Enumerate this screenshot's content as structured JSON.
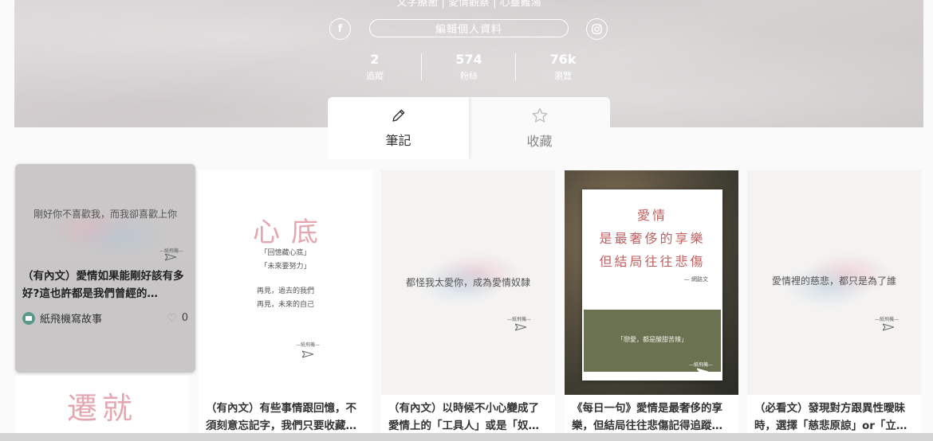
{
  "profile": {
    "bio": "文字療癒 | 愛情觀察 | 心靈雞湯",
    "edit_label": "編輯個人資料",
    "facebook_glyph": "f",
    "stats": [
      {
        "value": "2",
        "label": "追蹤"
      },
      {
        "value": "574",
        "label": "粉絲"
      },
      {
        "value": "76k",
        "label": "瀏覽"
      }
    ]
  },
  "tabs": [
    {
      "label": "筆記",
      "icon": "pencil-icon",
      "active": true
    },
    {
      "label": "收藏",
      "icon": "star-icon",
      "active": false
    }
  ],
  "cards": [
    {
      "quote": "剛好你不喜歡我，而我卻喜歡上你",
      "signature": "—紙飛機—",
      "title": "（有內文）愛情如果能剛好該有多好?這也許都是我們曾經的…",
      "author": "紙飛機寫故事",
      "likes": "0"
    },
    {
      "heading": "心底",
      "lines": [
        "「回憶藏心底」",
        "「未來要努力」",
        "再見，過去的我們",
        "再見，未來的自己"
      ],
      "signature": "—紙飛機—",
      "title": "（有內文）有些事情跟回憶，不須刻意忘記字，我們只要收藏…"
    },
    {
      "quote": "都怪我太愛你，成為愛情奴隸",
      "signature": "—紙飛機—",
      "title": "（有內文）以時候不小心變成了愛情上的「工具人」或是「奴…"
    },
    {
      "poem": [
        "愛情",
        "是最奢侈的享樂",
        "但結局往往悲傷"
      ],
      "poem_author": "— 網路文",
      "caption": "「戀愛，都是酸甜苦辣」",
      "signature": "—紙飛機—",
      "title": "《每日一句》愛情是最奢侈的享樂，但結局往往悲傷記得追蹤…"
    },
    {
      "quote": "愛情裡的慈悲，都只是為了誰",
      "signature": "—紙飛機—",
      "title": "（必看文）發現對方跟異性曖昧時，選擇「慈悲原諒」or「立…"
    },
    {
      "heading": "遷就"
    }
  ],
  "colors": {
    "banner": "#d0cbcc",
    "pink_accent": "#e9b0ba",
    "blue_accent": "#a9c6d8",
    "poem_red": "#c06060",
    "olive_panel": "#6b7252"
  }
}
